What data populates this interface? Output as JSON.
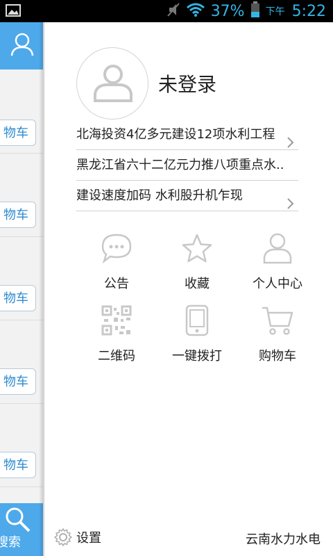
{
  "status": {
    "battery_percent": "37%",
    "ampm": "下午",
    "time": "5:22"
  },
  "background_panel": {
    "cart_label_fragment": "物车",
    "search_label_fragment": "搜索"
  },
  "profile": {
    "login_status": "未登录"
  },
  "news": [
    {
      "title": "北海投资4亿多元建设12项水利工程"
    },
    {
      "title": "黑龙江省六十二亿元力推八项重点水..."
    },
    {
      "title": "建设速度加码 水利股升机乍现"
    }
  ],
  "menu": [
    {
      "label": "公告",
      "icon": "chat-icon"
    },
    {
      "label": "收藏",
      "icon": "star-icon"
    },
    {
      "label": "个人中心",
      "icon": "person-icon"
    },
    {
      "label": "二维码",
      "icon": "qr-code-icon"
    },
    {
      "label": "一键拨打",
      "icon": "phone-icon"
    },
    {
      "label": "购物车",
      "icon": "cart-icon"
    }
  ],
  "footer": {
    "settings_label": "设置",
    "brand": "云南水力水电"
  },
  "colors": {
    "accent_blue": "#4da9ea",
    "status_blue": "#33b5e5",
    "icon_gray": "#c8c8c8"
  }
}
